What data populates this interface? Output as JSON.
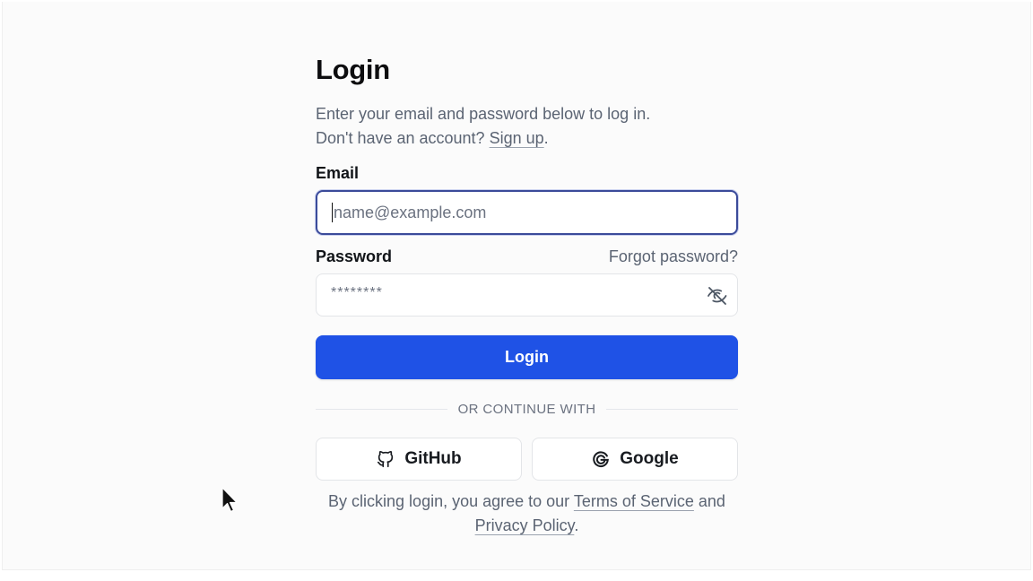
{
  "form": {
    "title": "Login",
    "subtitle_line1": "Enter your email and password below to log in.",
    "subtitle_line2_prefix": "Don't have an account? ",
    "signup_link": "Sign up",
    "subtitle_line2_suffix": ".",
    "email_label": "Email",
    "email_placeholder": "name@example.com",
    "email_value": "",
    "password_label": "Password",
    "forgot_password": "Forgot password?",
    "password_value": "********",
    "password_toggle_icon": "eye-off-icon",
    "login_button": "Login",
    "divider_text": "OR CONTINUE WITH",
    "github_button": "GitHub",
    "github_icon": "github-icon",
    "google_button": "Google",
    "google_icon": "google-icon",
    "terms_prefix": "By clicking login, you agree to our ",
    "terms_link": "Terms of Service",
    "terms_middle": " and ",
    "privacy_link": "Privacy Policy",
    "terms_suffix": "."
  },
  "colors": {
    "primary": "#1f52e6",
    "muted_text": "#5b6473",
    "focus_border": "#3b4b9a"
  },
  "cursor": {
    "icon": "mouse-pointer-icon"
  }
}
